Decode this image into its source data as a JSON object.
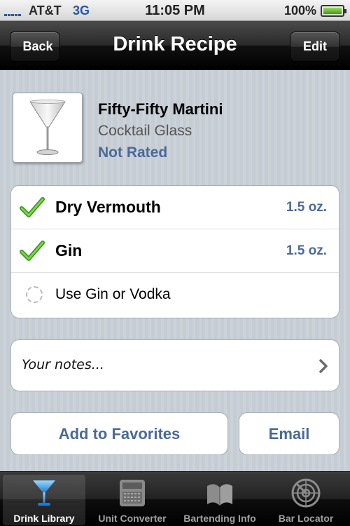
{
  "status_bar": {
    "carrier": "AT&T",
    "network": "3G",
    "time": "11:05 PM",
    "battery": "100%"
  },
  "nav": {
    "back_label": "Back",
    "title": "Drink Recipe",
    "edit_label": "Edit"
  },
  "drink": {
    "name": "Fifty-Fifty Martini",
    "glass": "Cocktail Glass",
    "rating": "Not Rated"
  },
  "ingredients": [
    {
      "name": "Dry Vermouth",
      "amount": "1.5 oz.",
      "checked": true
    },
    {
      "name": "Gin",
      "amount": "1.5 oz.",
      "checked": true
    },
    {
      "name": "Use Gin or Vodka",
      "amount": "",
      "checked": false
    }
  ],
  "notes": {
    "label": "Your notes..."
  },
  "actions": {
    "favorites_label": "Add to Favorites",
    "email_label": "Email"
  },
  "tabs": [
    {
      "label": "Drink Library",
      "icon": "martini-glass-icon",
      "active": true
    },
    {
      "label": "Unit Converter",
      "icon": "calculator-icon",
      "active": false
    },
    {
      "label": "Bartending Info",
      "icon": "book-icon",
      "active": false
    },
    {
      "label": "Bar Locator",
      "icon": "radar-icon",
      "active": false
    }
  ],
  "colors": {
    "accent_blue": "#4a6a98",
    "check_green": "#3e9a1e"
  }
}
